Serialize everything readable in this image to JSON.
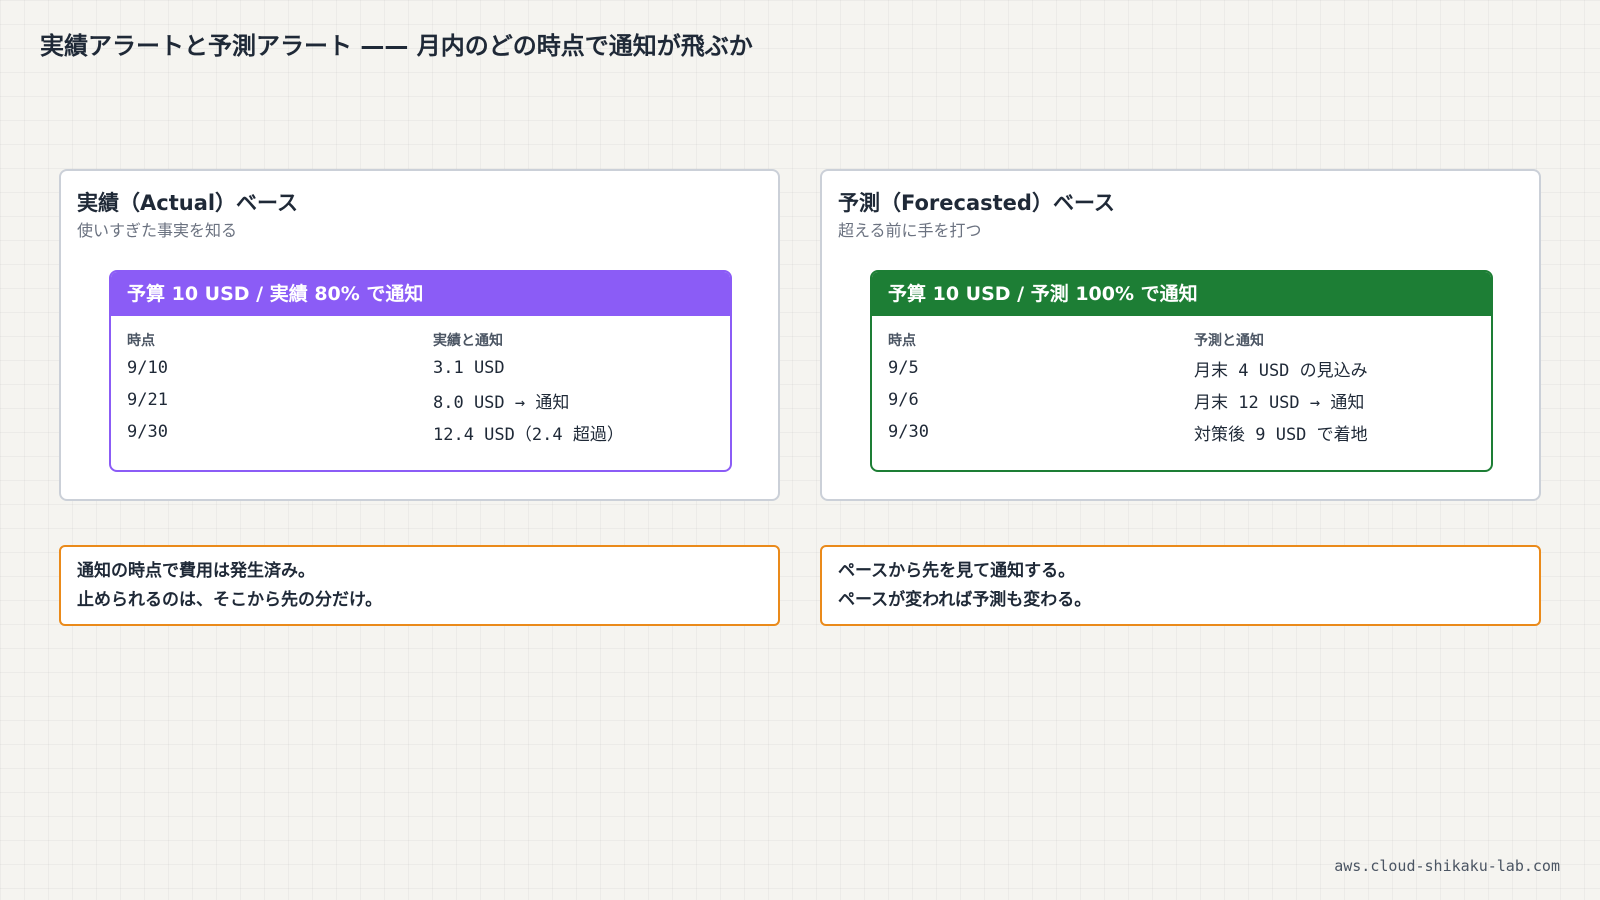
{
  "page": {
    "title": "実績アラートと予測アラート —— 月内のどの時点で通知が飛ぶか",
    "footer_url": "aws.cloud-shikaku-lab.com"
  },
  "colors": {
    "actual_accent": "#8b5cf6",
    "forecast_accent": "#1d7e35",
    "note_border": "#ea8a1a"
  },
  "actual_panel": {
    "title": "実績（Actual）ベース",
    "subtitle": "使いすぎた事実を知る",
    "card": {
      "header": "予算 10 USD / 実績 80% で通知",
      "col_time": "時点",
      "col_value": "実績と通知",
      "rows": [
        {
          "time": "9/10",
          "value": "3.1 USD"
        },
        {
          "time": "9/21",
          "value": "8.0 USD → 通知"
        },
        {
          "time": "9/30",
          "value": "12.4 USD（2.4 超過）"
        }
      ]
    },
    "note": [
      "通知の時点で費用は発生済み。",
      "止められるのは、そこから先の分だけ。"
    ]
  },
  "forecast_panel": {
    "title": "予測（Forecasted）ベース",
    "subtitle": "超える前に手を打つ",
    "card": {
      "header": "予算 10 USD / 予測 100% で通知",
      "col_time": "時点",
      "col_value": "予測と通知",
      "rows": [
        {
          "time": "9/5",
          "value": "月末 4 USD の見込み"
        },
        {
          "time": "9/6",
          "value": "月末 12 USD → 通知"
        },
        {
          "time": "9/30",
          "value": "対策後 9 USD で着地"
        }
      ]
    },
    "note": [
      "ペースから先を見て通知する。",
      "ペースが変われば予測も変わる。"
    ]
  }
}
